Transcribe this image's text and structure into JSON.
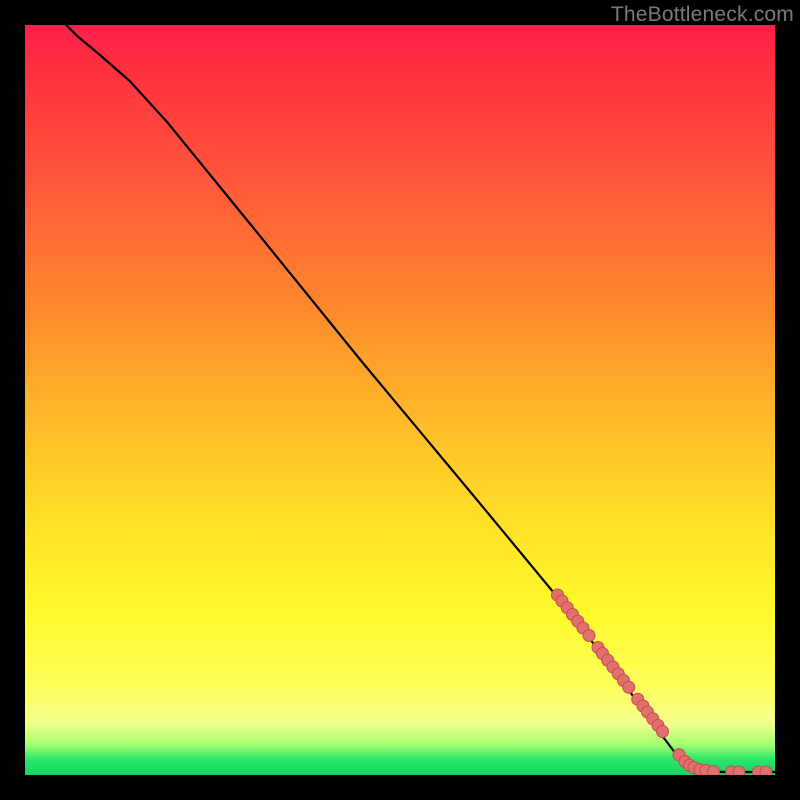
{
  "watermark": "TheBottleneck.com",
  "chart_data": {
    "type": "line",
    "title": "",
    "xlabel": "",
    "ylabel": "",
    "xlim": [
      0,
      100
    ],
    "ylim": [
      0,
      100
    ],
    "grid": false,
    "legend": false,
    "colors": {
      "curve": "#000000",
      "marker_fill": "#e2706e",
      "marker_stroke": "#c24e4f"
    },
    "curve": {
      "comment": "Main black curve, approximate shape: starts top-left, slight shoulder, then near-linear descent to a knee near bottom-right, then flat along bottom.",
      "points": [
        {
          "x": 5.5,
          "y": 100.0
        },
        {
          "x": 7.0,
          "y": 98.5
        },
        {
          "x": 10.0,
          "y": 96.0
        },
        {
          "x": 14.0,
          "y": 92.5
        },
        {
          "x": 19.0,
          "y": 87.0
        },
        {
          "x": 30.0,
          "y": 73.5
        },
        {
          "x": 45.0,
          "y": 55.0
        },
        {
          "x": 60.0,
          "y": 37.0
        },
        {
          "x": 72.0,
          "y": 22.5
        },
        {
          "x": 80.0,
          "y": 12.0
        },
        {
          "x": 84.0,
          "y": 6.5
        },
        {
          "x": 86.5,
          "y": 3.2
        },
        {
          "x": 88.0,
          "y": 1.6
        },
        {
          "x": 90.0,
          "y": 0.7
        },
        {
          "x": 93.0,
          "y": 0.4
        },
        {
          "x": 100.0,
          "y": 0.4
        }
      ]
    },
    "series": [
      {
        "name": "markers",
        "comment": "Salmon circular markers clustered along the lower-right portion of the curve plus a few along the flat bottom.",
        "values": [
          {
            "x": 71.0,
            "y": 24.0,
            "r": 6
          },
          {
            "x": 71.6,
            "y": 23.2,
            "r": 6
          },
          {
            "x": 72.3,
            "y": 22.3,
            "r": 6
          },
          {
            "x": 73.0,
            "y": 21.4,
            "r": 6
          },
          {
            "x": 73.7,
            "y": 20.5,
            "r": 6
          },
          {
            "x": 74.4,
            "y": 19.6,
            "r": 6
          },
          {
            "x": 75.2,
            "y": 18.6,
            "r": 6
          },
          {
            "x": 76.4,
            "y": 17.0,
            "r": 6
          },
          {
            "x": 77.0,
            "y": 16.2,
            "r": 6
          },
          {
            "x": 77.7,
            "y": 15.3,
            "r": 6
          },
          {
            "x": 78.4,
            "y": 14.4,
            "r": 6
          },
          {
            "x": 79.1,
            "y": 13.5,
            "r": 6
          },
          {
            "x": 79.8,
            "y": 12.6,
            "r": 6
          },
          {
            "x": 80.5,
            "y": 11.7,
            "r": 6
          },
          {
            "x": 81.7,
            "y": 10.1,
            "r": 6
          },
          {
            "x": 82.4,
            "y": 9.2,
            "r": 6
          },
          {
            "x": 83.0,
            "y": 8.4,
            "r": 6
          },
          {
            "x": 83.7,
            "y": 7.5,
            "r": 6
          },
          {
            "x": 84.4,
            "y": 6.6,
            "r": 6
          },
          {
            "x": 85.0,
            "y": 5.8,
            "r": 6
          },
          {
            "x": 87.2,
            "y": 2.7,
            "r": 6
          },
          {
            "x": 88.0,
            "y": 1.8,
            "r": 6
          },
          {
            "x": 88.6,
            "y": 1.3,
            "r": 6
          },
          {
            "x": 89.2,
            "y": 1.0,
            "r": 6
          },
          {
            "x": 90.0,
            "y": 0.7,
            "r": 6
          },
          {
            "x": 90.8,
            "y": 0.6,
            "r": 6
          },
          {
            "x": 91.8,
            "y": 0.45,
            "r": 6
          },
          {
            "x": 94.2,
            "y": 0.4,
            "r": 6
          },
          {
            "x": 95.2,
            "y": 0.4,
            "r": 6
          },
          {
            "x": 97.8,
            "y": 0.4,
            "r": 6
          },
          {
            "x": 98.8,
            "y": 0.4,
            "r": 6
          }
        ]
      }
    ]
  }
}
